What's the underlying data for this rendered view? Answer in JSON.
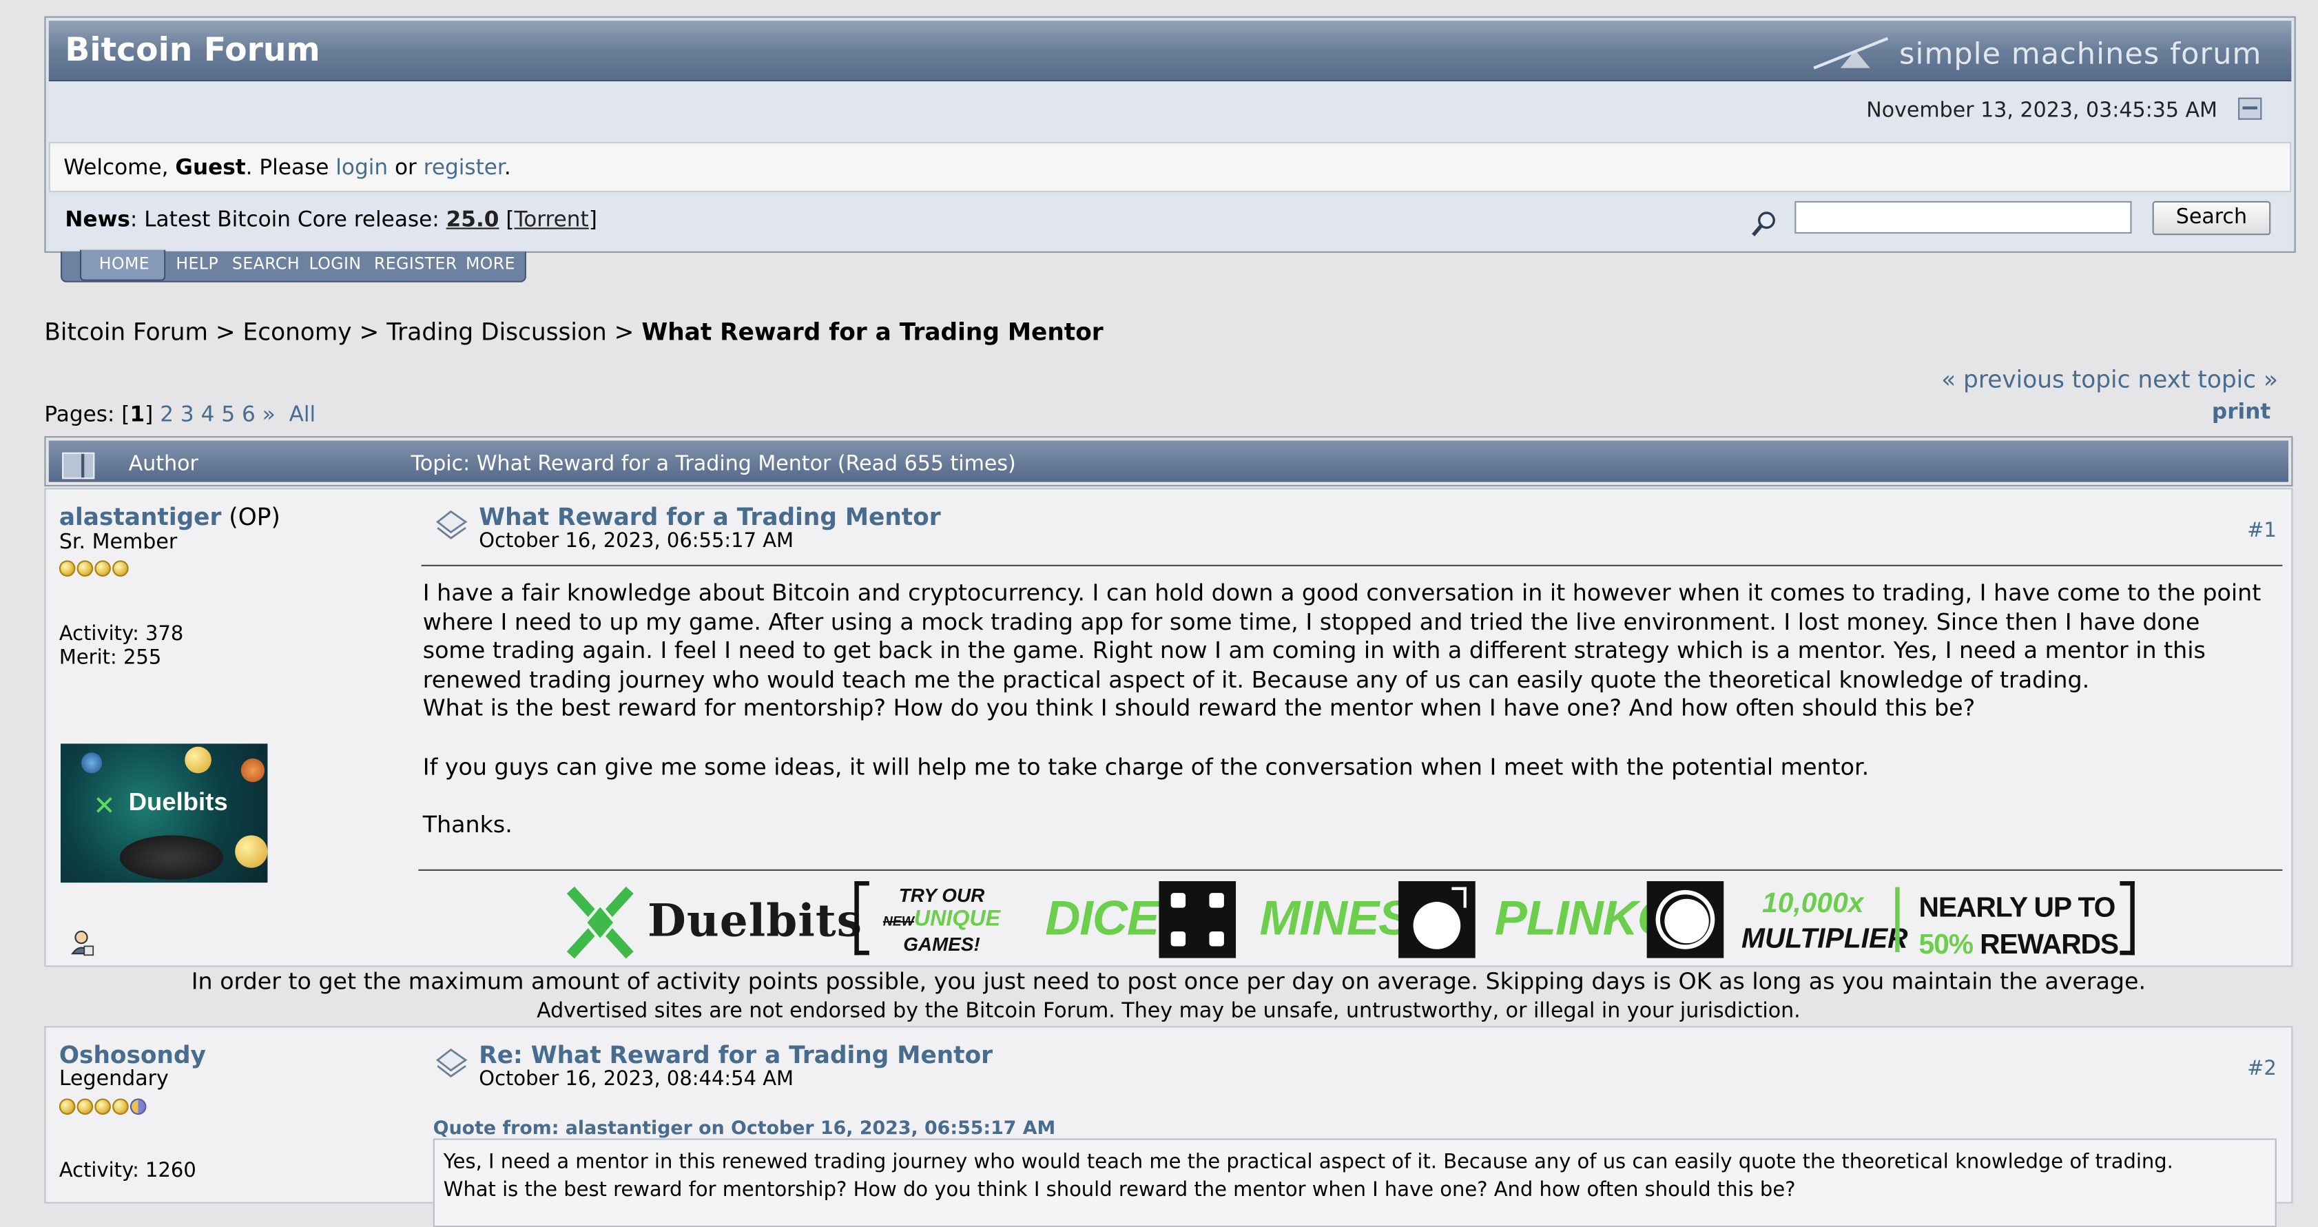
{
  "header": {
    "forum_title": "Bitcoin Forum",
    "brand": "simple machines forum",
    "datetime": "November 13, 2023, 03:45:35 AM",
    "welcome_prefix": "Welcome, ",
    "welcome_user": "Guest",
    "welcome_mid": ". Please ",
    "login_label": "login",
    "or_label": " or ",
    "register_label": "register",
    "period": ".",
    "news_label": "News",
    "news_text": ": Latest Bitcoin Core release: ",
    "news_version": "25.0",
    "news_torrent": "Torrent",
    "search_value": "",
    "search_button": "Search"
  },
  "menu": {
    "home": "HOME",
    "help": "HELP",
    "search": "SEARCH",
    "login": "LOGIN",
    "register": "REGISTER",
    "more": "MORE"
  },
  "breadcrumb": {
    "c1": "Bitcoin Forum",
    "c2": "Economy",
    "c3": "Trading Discussion",
    "current": "What Reward for a Trading Mentor",
    "sep": " > "
  },
  "nav": {
    "prev": "« previous topic",
    "next": "next topic »",
    "print": "print",
    "pages_label": "Pages: ",
    "current_page": "1",
    "pages": [
      "2",
      "3",
      "4",
      "5",
      "6"
    ],
    "next_arrow": "»",
    "all": "All"
  },
  "topic_header": {
    "author_label": "Author",
    "topic_text": "Topic: What Reward for a Trading Mentor  (Read 655 times)"
  },
  "posts": [
    {
      "username": "alastantiger",
      "op_tag": " (OP)",
      "rank": "Sr. Member",
      "stars": 4,
      "activity": "Activity: 378",
      "merit": "Merit: 255",
      "title": "What Reward for a Trading Mentor",
      "date": "October 16, 2023, 06:55:17 AM",
      "number": "#1",
      "body": [
        "I have a fair knowledge about Bitcoin and cryptocurrency. I can hold down a good conversation in it however when it comes to trading, I have come to the point where I need to up my game. After using a mock trading app for some time, I stopped and tried the live environment. I lost money. Since then I have done some trading again. I feel I need to get back in the game. Right now I am coming in with a different strategy which is a mentor. Yes, I need a mentor in this renewed trading journey who would teach me the practical aspect of it. Because any of us can easily quote the theoretical knowledge of trading.",
        "What is the best reward for mentorship? How do you think I should reward the mentor when I have one? And how often should this be?",
        "",
        "If you guys can give me some ideas, it will help me to take charge of the conversation when I meet with the potential mentor.",
        "",
        "Thanks."
      ],
      "avatar_text": "Duelbits"
    },
    {
      "username": "Oshosondy",
      "rank": "Legendary",
      "stars": 5,
      "activity": "Activity: 1260",
      "title": "Re: What Reward for a Trading Mentor",
      "date": "October 16, 2023, 08:44:54 AM",
      "number": "#2",
      "quote_header": "Quote from: alastantiger on October 16, 2023, 06:55:17 AM",
      "quote_lines": [
        "Yes, I need a mentor in this renewed trading journey who would teach me the practical aspect of it. Because any of us can easily quote the theoretical knowledge of trading.",
        "What is the best reward for mentorship? How do you think I should reward the mentor when I have one? And how often should this be?"
      ]
    }
  ],
  "banner": {
    "brand": "Duelbits",
    "try_line1": "TRY OUR",
    "try_new": "NEW",
    "try_unique": "UNIQUE",
    "try_line3": "GAMES!",
    "dice": "DICE",
    "mines": "MINES",
    "plinko": "PLINKO",
    "mult_value": "10,000x",
    "mult_label": "MULTIPLIER",
    "rew_line1": "NEARLY UP TO",
    "rew_pct": "50%",
    "rew_label": " REWARDS"
  },
  "notices": {
    "activity": "In order to get the maximum amount of activity points possible, you just need to post once per day on average. Skipping days is OK as long as you maintain the average.",
    "ads": "Advertised sites are not endorsed by the Bitcoin Forum. They may be unsafe, untrustworthy, or illegal in your jurisdiction."
  },
  "colors": {
    "link": "#476c8e",
    "header_blue": "#5f7493",
    "banner_green": "#6ccf4c"
  }
}
